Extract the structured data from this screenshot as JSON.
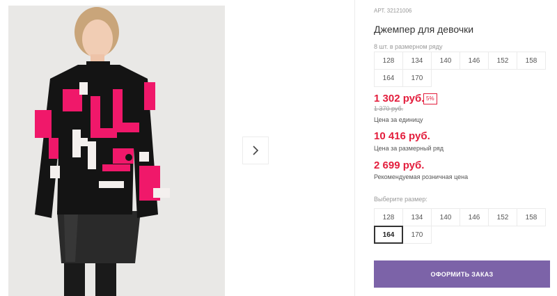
{
  "gallery": {
    "photo_alt": "Джемпер для девочки",
    "next_icon": "chevron-right-icon"
  },
  "product": {
    "art_label": "АРТ.",
    "art_number": "32121006",
    "title": "Джемпер для девочки",
    "range_caption": "8 шт. в размерном ряду",
    "range_sizes": [
      "128",
      "134",
      "140",
      "146",
      "152",
      "158",
      "164",
      "170"
    ],
    "price_unit": "1 302 руб.",
    "discount": "5%",
    "old_price": "1 370 руб.",
    "price_unit_caption": "Цена за единицу",
    "price_range": "10 416 руб.",
    "price_range_caption": "Цена за размерный ряд",
    "price_retail": "2 699 руб.",
    "price_retail_caption": "Рекомендуемая розничная цена",
    "select_caption": "Выберите размер:",
    "select_sizes": [
      "128",
      "134",
      "140",
      "146",
      "152",
      "158",
      "164",
      "170"
    ],
    "selected_size": "164",
    "order_button": "ОФОРМИТЬ ЗАКАЗ"
  },
  "colors": {
    "price_red": "#e31d3c",
    "button_purple": "#7c63a8",
    "sweater_pink": "#f0186a"
  }
}
